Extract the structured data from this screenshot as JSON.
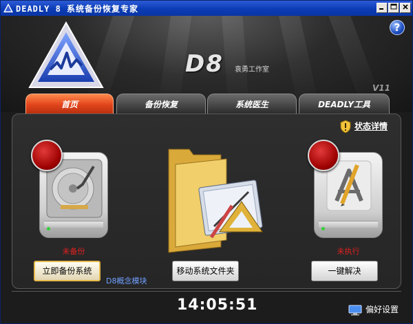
{
  "window": {
    "title": "DEADLY 8 系统备份恢复专家",
    "controls": [
      "minimize",
      "maximize",
      "close"
    ]
  },
  "header": {
    "brand": "D8",
    "studio": "袁勇工作室",
    "version": "V11"
  },
  "tabs": [
    {
      "label": "首页",
      "active": true
    },
    {
      "label": "备份恢复",
      "active": false
    },
    {
      "label": "系统医生",
      "active": false
    },
    {
      "label": "DEADLY工具",
      "active": false
    }
  ],
  "panel": {
    "status_link": "状态详情",
    "backup": {
      "status": "未备份",
      "button": "立即备份系统"
    },
    "module_link": "D8概念模块",
    "move": {
      "button": "移动系统文件夹"
    },
    "fix": {
      "status": "未执行",
      "button": "一键解决"
    }
  },
  "footer": {
    "clock": "14:05:51",
    "preferences": "偏好设置"
  },
  "colors": {
    "active_tab": "#e2451c",
    "status_red": "#e02020",
    "title_bar": "#0b3cb5"
  }
}
